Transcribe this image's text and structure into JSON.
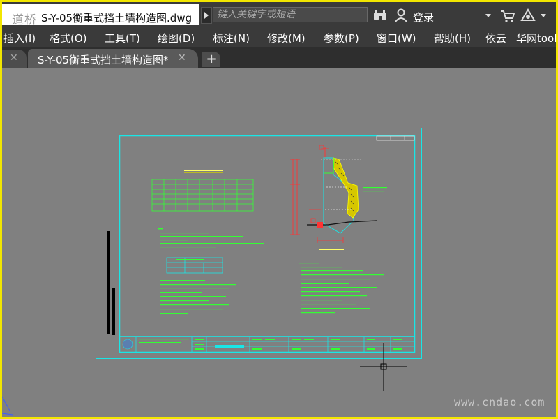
{
  "titlebar": {
    "watermark_logo": "道桥",
    "file_title": "S-Y-05衡重式挡土墙构造图.dwg",
    "search_placeholder": "键入关键字或短语",
    "login_label": "登录"
  },
  "menu": {
    "items": [
      "插入(I)",
      "格式(O)",
      "工具(T)",
      "绘图(D)",
      "标注(N)",
      "修改(M)",
      "参数(P)",
      "窗口(W)",
      "帮助(H)",
      "依云",
      "华网tool"
    ]
  },
  "tabs": {
    "active_label": "S-Y-05衡重式挡土墙构造图*",
    "close_glyph": "✕",
    "new_glyph": "+"
  },
  "watermark": {
    "site": "www.cndao.com"
  },
  "colors": {
    "title_bg": "#3a3a3a",
    "canvas_bg": "#808080",
    "cad_cyan": "#19e6e6",
    "cad_green": "#33ff33",
    "cad_red": "#ff3333",
    "cad_yellow": "#ffff00",
    "frame_yellow": "#f2e600"
  },
  "icons": [
    "binoculars-icon",
    "user-icon",
    "cart-icon",
    "a360-icon",
    "crosshair-cursor-icon",
    "ucs-icon"
  ]
}
